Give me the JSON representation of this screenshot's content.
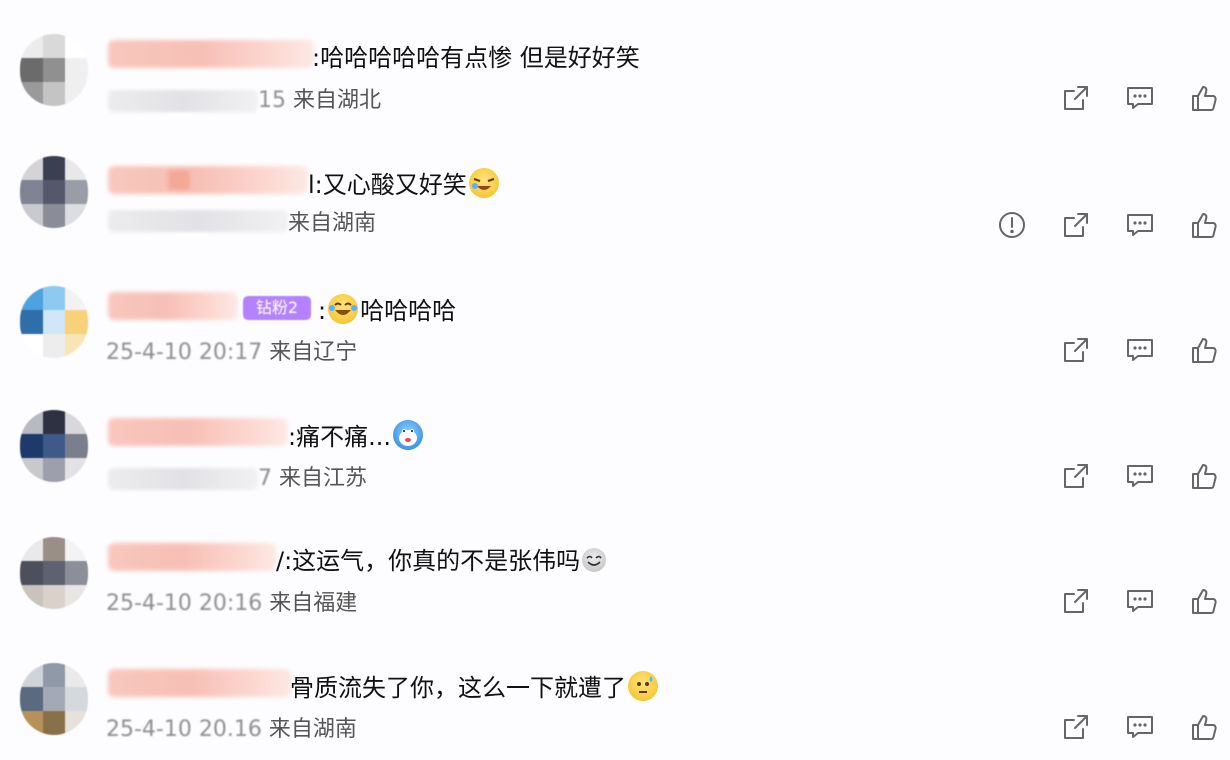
{
  "comments": [
    {
      "text": ":哈哈哈哈哈有点惨  但是好好笑",
      "date": "15",
      "location": "来自湖北",
      "has_report": false,
      "emoji": ""
    },
    {
      "text": "l:又心酸又好笑",
      "date": "",
      "location": "来自湖南",
      "has_report": true,
      "emoji": "cry-laugh-emoji"
    },
    {
      "text": ":",
      "text2": "哈哈哈哈",
      "date": "25-4-10 20:17",
      "location": "来自辽宁",
      "has_report": false,
      "emoji": "laugh-emoji",
      "badge": "钻粉2"
    },
    {
      "text": ":痛不痛...",
      "date": "7",
      "location": "来自江苏",
      "has_report": false,
      "emoji": "doge-emoji"
    },
    {
      "text": "/:这运气，你真的不是张伟吗",
      "date": "25-4-10 20:16",
      "location": "来自福建",
      "has_report": false,
      "emoji": "smile-emoji"
    },
    {
      "text": "骨质流失了你，这么一下就遭了",
      "date": "25-4-10 20.16",
      "location": "来自湖南",
      "has_report": false,
      "emoji": "sweat-emoji"
    }
  ],
  "colors": {
    "icon": "#666666",
    "badge": "#b582ff",
    "blur_pink": "#f8c7bd"
  }
}
